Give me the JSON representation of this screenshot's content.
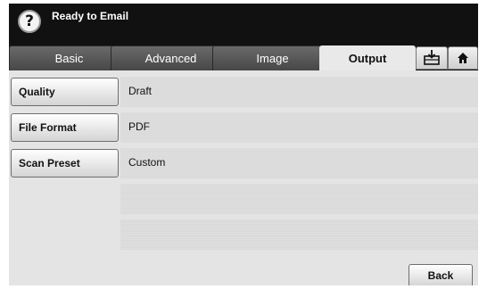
{
  "header": {
    "help_icon": "?",
    "title": "Ready to Email"
  },
  "tabs": [
    {
      "label": "Basic",
      "active": false
    },
    {
      "label": "Advanced",
      "active": false
    },
    {
      "label": "Image",
      "active": false
    },
    {
      "label": "Output",
      "active": true
    }
  ],
  "tab_icons": [
    "job-status-icon",
    "home-icon"
  ],
  "options": [
    {
      "button_label": "Quality",
      "value": "Draft"
    },
    {
      "button_label": "File Format",
      "value": "PDF"
    },
    {
      "button_label": "Scan Preset",
      "value": "Custom"
    }
  ],
  "footer": {
    "back_label": "Back"
  }
}
